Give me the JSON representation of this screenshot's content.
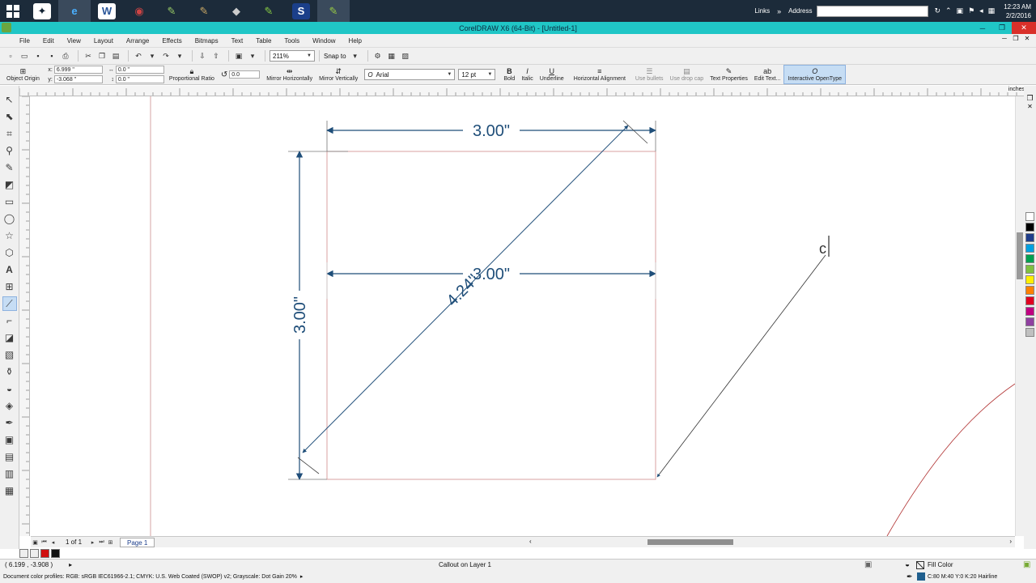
{
  "taskbar": {
    "apps": [
      {
        "name": "start",
        "icon": "windows-logo-icon"
      },
      {
        "name": "app-1",
        "icon": "app-icon"
      },
      {
        "name": "internet-explorer",
        "icon": "internet-explorer-icon"
      },
      {
        "name": "word",
        "icon": "word-icon"
      },
      {
        "name": "app-4",
        "icon": "app-icon"
      },
      {
        "name": "app-5",
        "icon": "app-icon"
      },
      {
        "name": "app-6",
        "icon": "app-icon"
      },
      {
        "name": "app-7",
        "icon": "app-icon"
      },
      {
        "name": "app-8",
        "icon": "app-icon"
      },
      {
        "name": "app-s",
        "label": "S"
      },
      {
        "name": "coreldraw",
        "icon": "coreldraw-icon"
      }
    ],
    "links_label": "Links",
    "address_label": "Address",
    "clock_time": "12:23 AM",
    "clock_date": "2/2/2016"
  },
  "titlebar": {
    "title": "CorelDRAW X6 (64-Bit) - [Untitled-1]"
  },
  "menu": [
    "File",
    "Edit",
    "View",
    "Layout",
    "Arrange",
    "Effects",
    "Bitmaps",
    "Text",
    "Table",
    "Tools",
    "Window",
    "Help"
  ],
  "stdbar": {
    "zoom": "211%",
    "snap_to": "Snap to"
  },
  "propbar": {
    "object_origin": "Object Origin",
    "x_value": "6.999 \"",
    "y_value": "-3.068 \"",
    "w_value": "0.0 \"",
    "h_value": "0.0 \"",
    "proportional_ratio": "Proportional Ratio",
    "rotation": "0.0",
    "mirror_h": "Mirror Horizontally",
    "mirror_v": "Mirror Vertically",
    "font": "Arial",
    "font_size": "12 pt",
    "bold": "Bold",
    "italic": "Italic",
    "underline": "Underline",
    "h_align": "Horizontal Alignment",
    "bullets": "Use bullets",
    "drop_cap": "Use drop cap",
    "text_props": "Text Properties",
    "edit_text": "Edit Text...",
    "opentype": "Interactive OpenType"
  },
  "ruler": {
    "units": "inches"
  },
  "drawing": {
    "dim_top": "3.00\"",
    "dim_mid": "3.00\"",
    "dim_left": "3.00\"",
    "dim_diag": "4.24\"",
    "callout_text": "c"
  },
  "pagenav": {
    "page_count": "1 of 1",
    "page_tab": "Page 1"
  },
  "status": {
    "coords": "( 6.199 , -3.908 )",
    "layer": "Callout on Layer 1",
    "profiles": "Document color profiles: RGB: sRGB IEC61966-2.1; CMYK: U.S. Web Coated (SWOP) v2; Grayscale: Dot Gain 20%",
    "fill_label": "Fill Color",
    "outline": "C:80 M:40 Y:0 K:20  Hairline"
  },
  "colors": {
    "accent_title": "#20c6c6",
    "dimension": "#1f4e79",
    "page_edge": "#d4a4a4",
    "fill_swatch": "#1f5f8e"
  },
  "palette": [
    "#ffffff",
    "#000000",
    "#1f3d8a",
    "#00a0e0",
    "#00a050",
    "#80c040",
    "#ffee00",
    "#ff8000",
    "#e00020",
    "#c00080",
    "#9040a0",
    "#c0c0c0"
  ]
}
